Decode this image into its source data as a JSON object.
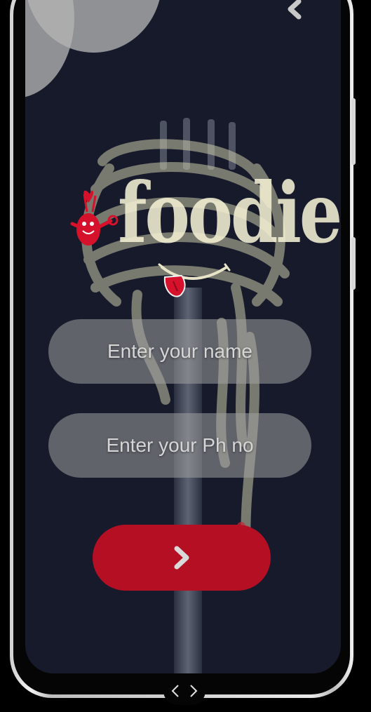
{
  "app": {
    "logo_text": "foodie",
    "name_field": {
      "placeholder": "Enter your name",
      "value": ""
    },
    "phone_field": {
      "placeholder": "Enter your Ph no",
      "value": ""
    }
  },
  "icons": {
    "back": "chevron-left-icon",
    "submit": "chevron-right-icon",
    "nav_back": "chevron-left-icon",
    "nav_forward": "chevron-right-icon"
  },
  "colors": {
    "screen_bg": "#161a2a",
    "accent": "#b50f24",
    "field_bg": "#a0a0a0",
    "logo": "#f3f0d4"
  }
}
